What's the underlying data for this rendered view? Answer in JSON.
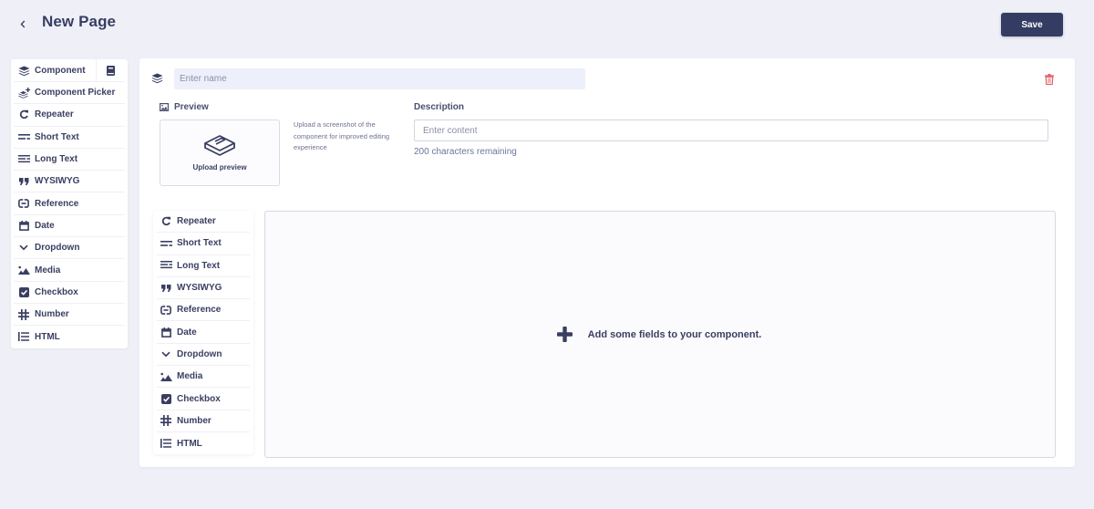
{
  "header": {
    "title": "New Page",
    "save_label": "Save"
  },
  "palette": {
    "top_item": {
      "label": "Component",
      "icon": "layers-icon"
    },
    "side_button_icon": "book-icon",
    "items": [
      {
        "label": "Component Picker",
        "icon": "layers-plus-icon"
      },
      {
        "label": "Repeater",
        "icon": "repeat-icon"
      },
      {
        "label": "Short Text",
        "icon": "short-text-icon"
      },
      {
        "label": "Long Text",
        "icon": "long-text-icon"
      },
      {
        "label": "WYSIWYG",
        "icon": "quote-icon"
      },
      {
        "label": "Reference",
        "icon": "link-icon"
      },
      {
        "label": "Date",
        "icon": "calendar-icon"
      },
      {
        "label": "Dropdown",
        "icon": "chevron-down-icon"
      },
      {
        "label": "Media",
        "icon": "image-icon"
      },
      {
        "label": "Checkbox",
        "icon": "checkbox-icon"
      },
      {
        "label": "Number",
        "icon": "hash-icon"
      },
      {
        "label": "HTML",
        "icon": "list-icon"
      }
    ]
  },
  "component": {
    "name_placeholder": "Enter name",
    "name_value": "",
    "preview_label": "Preview",
    "upload_label": "Upload preview",
    "upload_hint": "Upload a screenshot of the component for improved editing experience",
    "description_label": "Description",
    "description_placeholder": "Enter content",
    "description_value": "",
    "chars_remaining": "200 characters remaining",
    "delete_color": "#e35b66"
  },
  "inner_palette": {
    "items": [
      {
        "label": "Repeater",
        "icon": "repeat-icon"
      },
      {
        "label": "Short Text",
        "icon": "short-text-icon"
      },
      {
        "label": "Long Text",
        "icon": "long-text-icon"
      },
      {
        "label": "WYSIWYG",
        "icon": "quote-icon"
      },
      {
        "label": "Reference",
        "icon": "link-icon"
      },
      {
        "label": "Date",
        "icon": "calendar-icon"
      },
      {
        "label": "Dropdown",
        "icon": "chevron-down-icon"
      },
      {
        "label": "Media",
        "icon": "image-icon"
      },
      {
        "label": "Checkbox",
        "icon": "checkbox-icon"
      },
      {
        "label": "Number",
        "icon": "hash-icon"
      },
      {
        "label": "HTML",
        "icon": "list-icon"
      }
    ]
  },
  "drop_zone": {
    "message": "Add some fields to your component."
  },
  "colors": {
    "primary": "#343c63",
    "background": "#eff0f7",
    "danger": "#e35b66"
  }
}
